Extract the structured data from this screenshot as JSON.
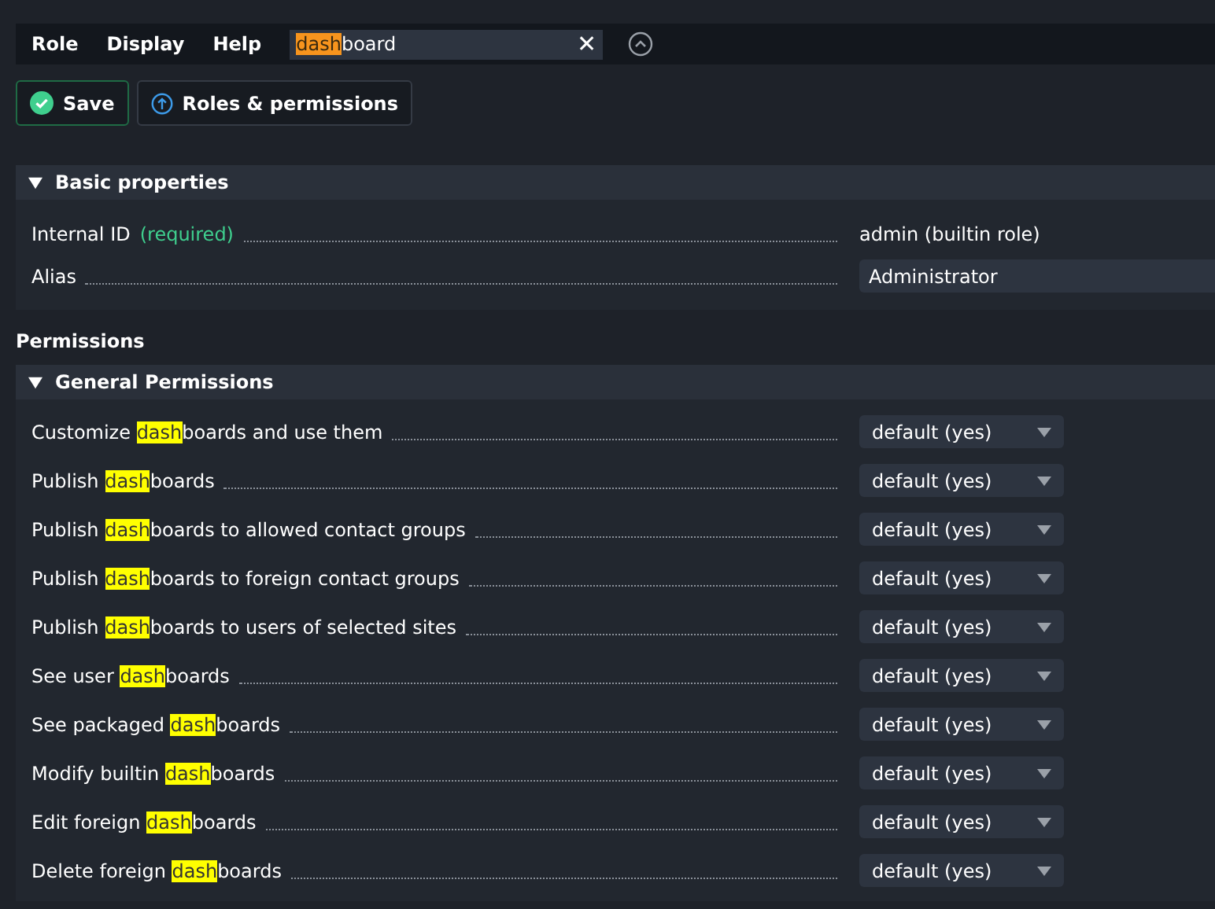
{
  "menu": [
    {
      "label": "Role"
    },
    {
      "label": "Display"
    },
    {
      "label": "Help"
    }
  ],
  "search": {
    "match": "dash",
    "rest": "board",
    "clear": "✕"
  },
  "buttons": [
    {
      "kind": "save",
      "label": "Save"
    },
    {
      "kind": "link",
      "label": "Roles & permissions"
    }
  ],
  "basic_properties": {
    "title": "Basic properties",
    "expanded": true,
    "rows": [
      {
        "label": "Internal ID",
        "note": "(required)",
        "kind": "text",
        "value": "admin (builtin role)"
      },
      {
        "label": "Alias",
        "kind": "input",
        "value": "Administrator"
      }
    ]
  },
  "permissions_heading": "Permissions",
  "general_permissions": {
    "title": "General Permissions",
    "expanded": true,
    "rows": [
      {
        "before": "Customize ",
        "match": "dash",
        "after": "boards and use them",
        "value": "default (yes)"
      },
      {
        "before": "Publish ",
        "match": "dash",
        "after": "boards",
        "value": "default (yes)"
      },
      {
        "before": "Publish ",
        "match": "dash",
        "after": "boards to allowed contact groups",
        "value": "default (yes)"
      },
      {
        "before": "Publish ",
        "match": "dash",
        "after": "boards to foreign contact groups",
        "value": "default (yes)"
      },
      {
        "before": "Publish ",
        "match": "dash",
        "after": "boards to users of selected sites",
        "value": "default (yes)"
      },
      {
        "before": "See user ",
        "match": "dash",
        "after": "boards",
        "value": "default (yes)"
      },
      {
        "before": "See packaged ",
        "match": "dash",
        "after": "boards",
        "value": "default (yes)"
      },
      {
        "before": "Modify builtin ",
        "match": "dash",
        "after": "boards",
        "value": "default (yes)"
      },
      {
        "before": "Edit foreign ",
        "match": "dash",
        "after": "boards",
        "value": "default (yes)"
      },
      {
        "before": "Delete foreign ",
        "match": "dash",
        "after": "boards",
        "value": "default (yes)"
      }
    ]
  }
}
